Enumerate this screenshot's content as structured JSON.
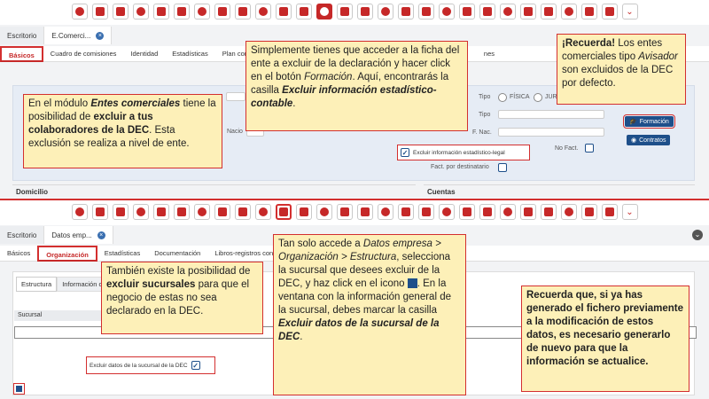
{
  "top": {
    "doc_tabs": [
      "Escritorio",
      "E.Comerci..."
    ],
    "sub_tabs": [
      "Básicos",
      "Cuadro de comisiones",
      "Identidad",
      "Estadísticas",
      "Plan con",
      "nes"
    ],
    "form": {
      "tipo": "Tipo",
      "fisica": "FÍSICA",
      "juridica": "JURÍ",
      "tipo2": "Tipo",
      "nacio": "Nacio",
      "f_nac": "F. Nac.",
      "no_fact": "No Fact.",
      "excluir": "Excluir información estadístico-legal",
      "fact_dest": "Fact. por destinatario",
      "domicilio": "Domicilio",
      "cuentas": "Cuentas"
    },
    "buttons": {
      "formacion": "Formación",
      "contratos": "Contratos"
    },
    "callout_left": {
      "p1": "En el módulo ",
      "b1": "Entes comerciales",
      "p2": " tiene la posibilidad de ",
      "b2": "excluir a tus colaboradores de la DEC",
      "p3": ". Esta exclusión se realiza a nivel de ente."
    },
    "callout_mid": {
      "p1": "Simplemente tienes que acceder a la ficha del ente a excluir de la declaración y hacer click en el botón ",
      "i1": "Formación",
      "p2": ". Aquí, encontrarás la casilla ",
      "b1": "Excluir información estadístico-contable",
      "p3": "."
    },
    "callout_right": {
      "b1": "¡Recuerda!",
      "p1": " Los entes comerciales tipo ",
      "i1": "Avisador",
      "p2": " son excluidos de la DEC por defecto."
    }
  },
  "bottom": {
    "doc_tabs": [
      "Escritorio",
      "Datos emp..."
    ],
    "sub_tabs": [
      "Básicos",
      "Organización",
      "Estadísticas",
      "Documentación",
      "Libros-registros conta"
    ],
    "inner_tabs": [
      "Estructura",
      "Información o"
    ],
    "col_sucursal": "Sucursal",
    "col_t": "T",
    "excluir": "Excluir datos de la sucursal de la DEC",
    "callout_left": {
      "p1": "También existe la posibilidad de ",
      "b1": "excluir sucursales",
      "p2": " para que el negocio de estas no sea declarado en la DEC."
    },
    "callout_mid": {
      "p1": "Tan solo accede a ",
      "i1": "Datos empresa > Organización > Estructura",
      "p2": ", selecciona la sucursal que desees excluir de la DEC, y haz click en el icono ",
      "p3": ". En la ventana con la información general de la sucursal, debes marcar la casilla ",
      "b1": "Excluir datos de la sucursal de la DEC",
      "p4": "."
    },
    "callout_right": {
      "b1": "Recuerda que, si ya has generado el fichero previamente a la modificación de estos datos, es necesario generarlo de nuevo para que la información se actualice."
    }
  }
}
